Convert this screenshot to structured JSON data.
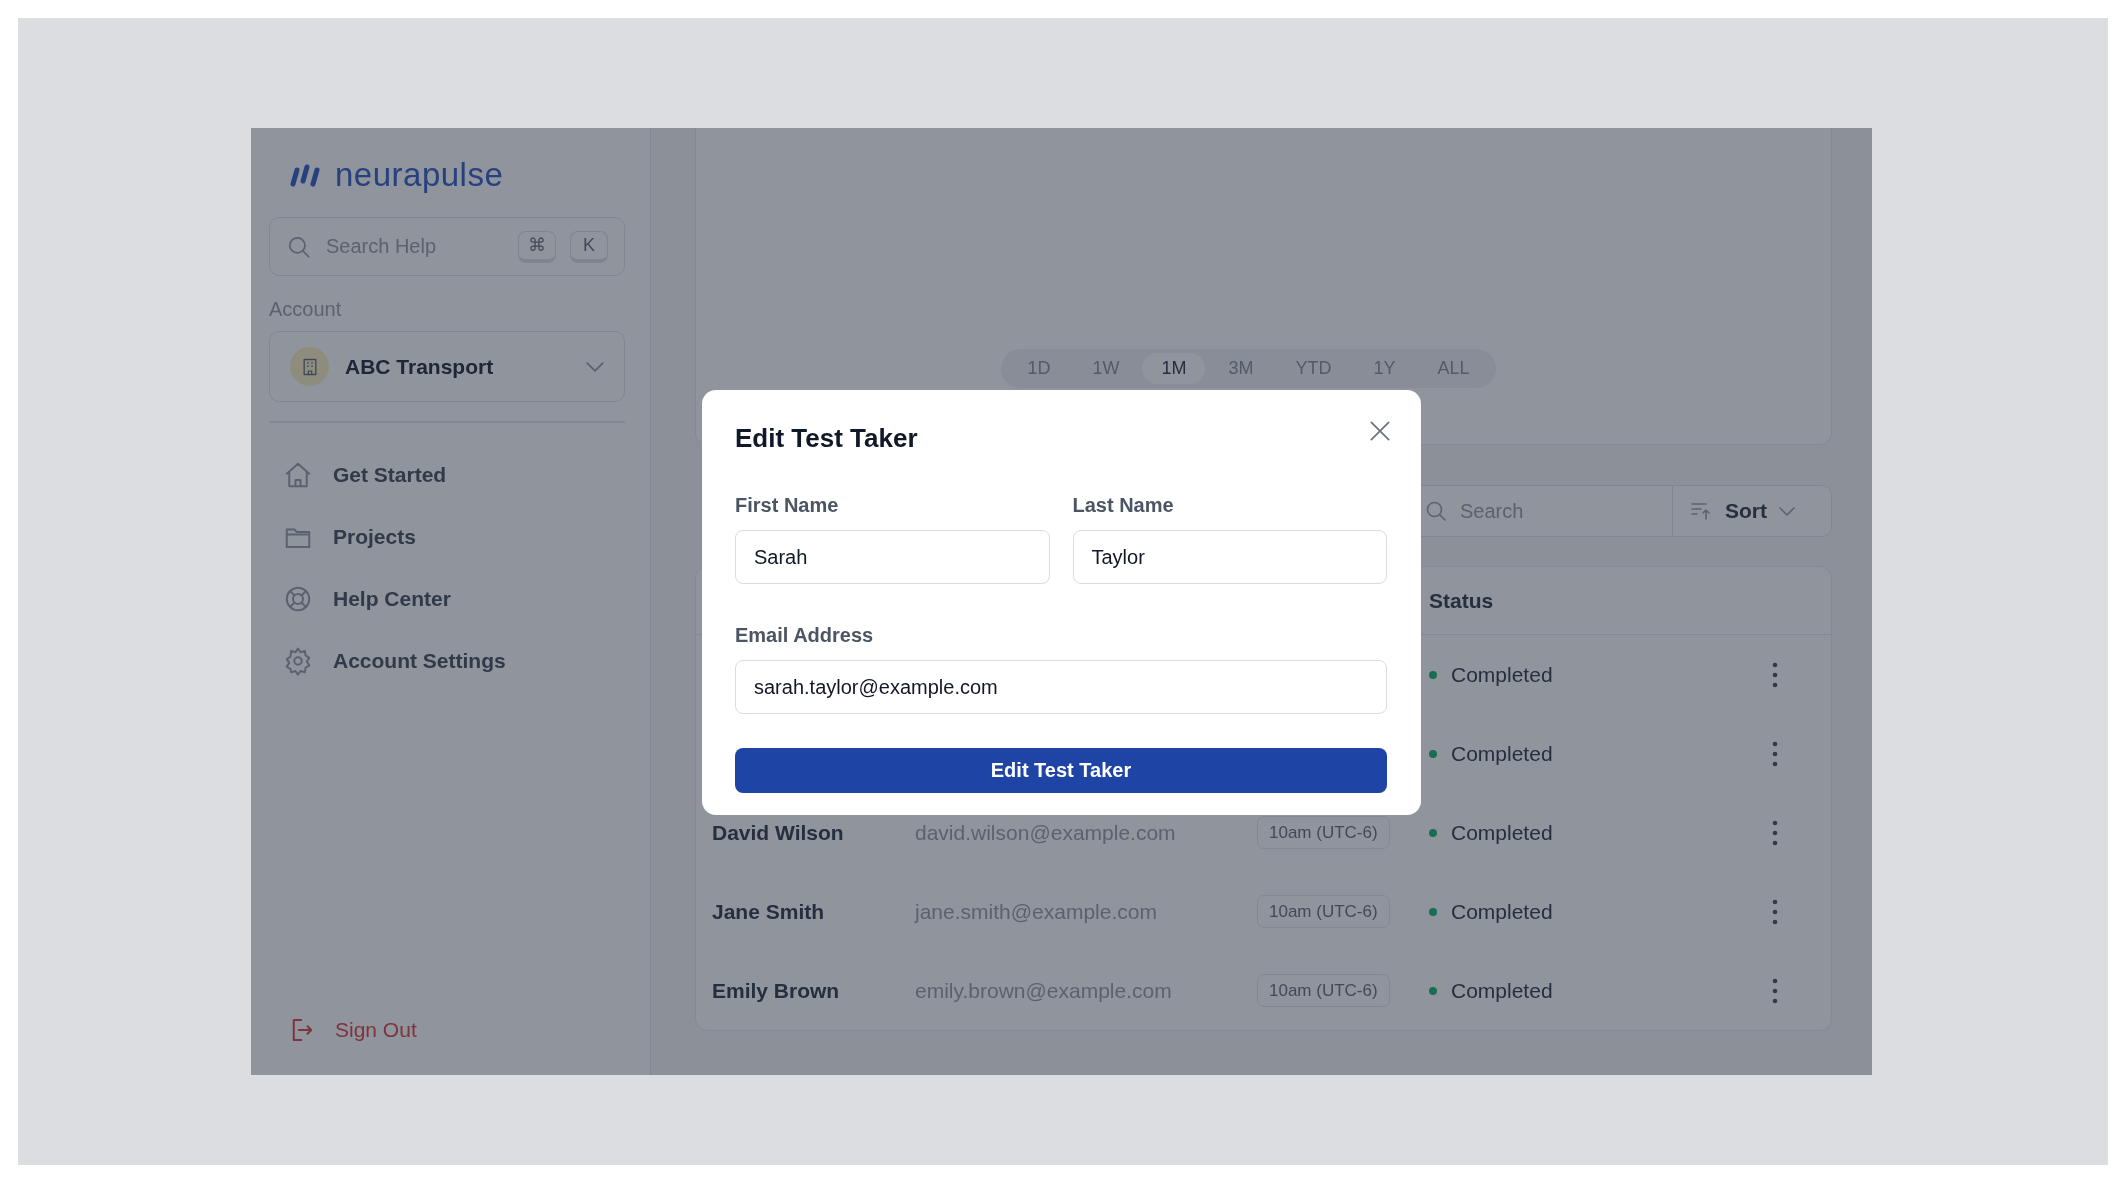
{
  "logo": {
    "text": "neurapulse"
  },
  "sidebar": {
    "search": {
      "placeholder": "Search Help",
      "keys": [
        "⌘",
        "K"
      ]
    },
    "account_label": "Account",
    "account": {
      "name": "ABC Transport"
    },
    "nav": [
      {
        "kind": "home",
        "label": "Get Started"
      },
      {
        "kind": "folder",
        "label": "Projects"
      },
      {
        "kind": "lifebuoy",
        "label": "Help Center"
      },
      {
        "kind": "gear",
        "label": "Account Settings"
      }
    ],
    "sign_out": "Sign Out"
  },
  "range_tabs": [
    {
      "label": "1D",
      "selected": false
    },
    {
      "label": "1W",
      "selected": false
    },
    {
      "label": "1M",
      "selected": true
    },
    {
      "label": "3M",
      "selected": false
    },
    {
      "label": "YTD",
      "selected": false
    },
    {
      "label": "1Y",
      "selected": false
    },
    {
      "label": "ALL",
      "selected": false
    }
  ],
  "toolbar": {
    "search": {
      "placeholder": "Search"
    },
    "sort": "Sort"
  },
  "table": {
    "status_column": "Status",
    "rows": [
      {
        "status": "Completed"
      },
      {
        "status": "Completed"
      },
      {
        "name": "David Wilson",
        "email": "david.wilson@example.com",
        "time": "10am (UTC-6)",
        "status": "Completed"
      },
      {
        "name": "Jane Smith",
        "email": "jane.smith@example.com",
        "time": "10am (UTC-6)",
        "status": "Completed"
      },
      {
        "name": "Emily Brown",
        "email": "emily.brown@example.com",
        "time": "10am (UTC-6)",
        "status": "Completed"
      }
    ]
  },
  "modal": {
    "title": "Edit Test Taker",
    "fields": [
      {
        "label": "First Name",
        "value": "Sarah"
      },
      {
        "label": "Last Name",
        "value": "Taylor"
      },
      {
        "label": "Email Address",
        "value": "sarah.taylor@example.com"
      }
    ],
    "submit": "Edit Test Taker"
  }
}
